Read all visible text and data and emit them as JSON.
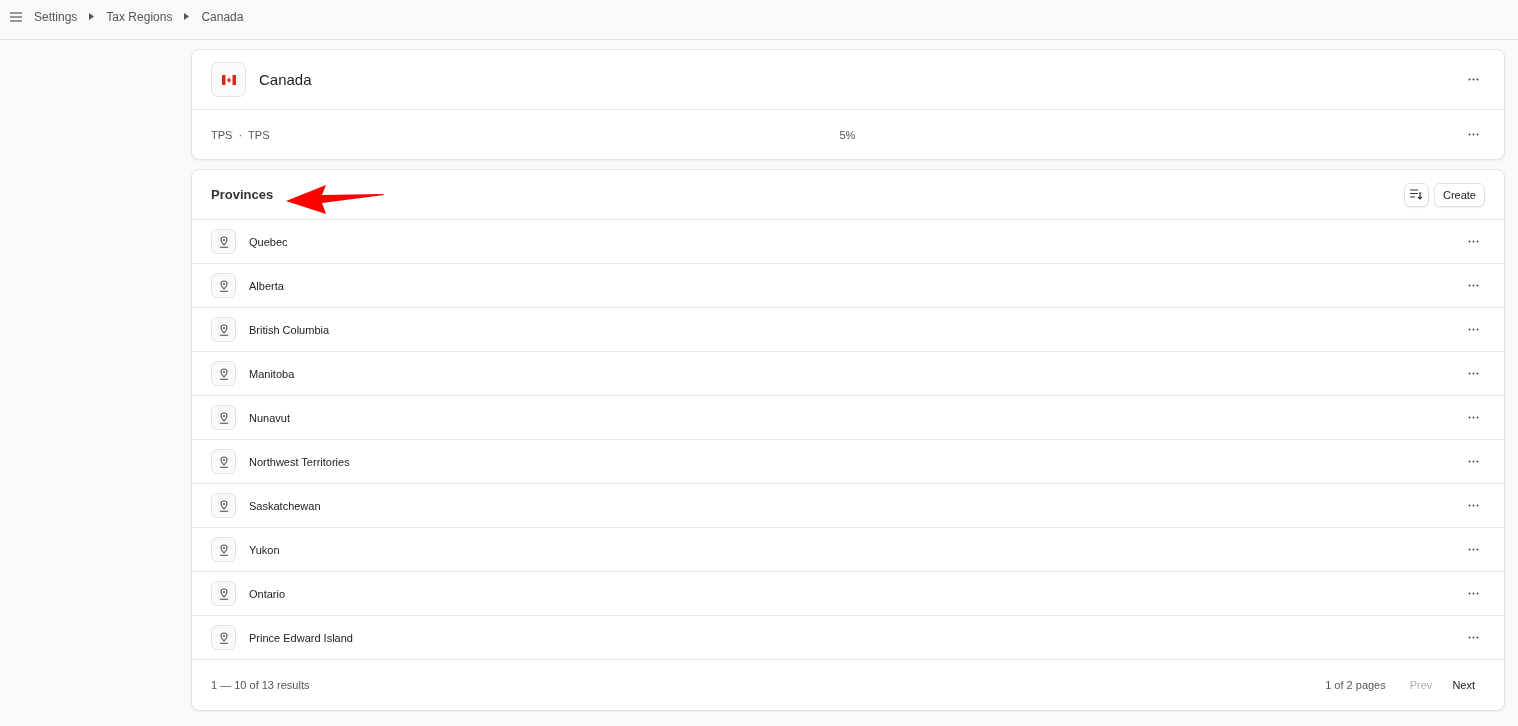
{
  "breadcrumb": [
    "Settings",
    "Tax Regions",
    "Canada"
  ],
  "region": {
    "name": "Canada",
    "rate": {
      "name": "TPS",
      "separator": "·",
      "code": "TPS",
      "value": "5%"
    }
  },
  "provinces": {
    "title": "Provinces",
    "create_label": "Create",
    "items": [
      "Quebec",
      "Alberta",
      "British Columbia",
      "Manitoba",
      "Nunavut",
      "Northwest Territories",
      "Saskatchewan",
      "Yukon",
      "Ontario",
      "Prince Edward Island"
    ],
    "results": "1 — 10 of 13 results",
    "pages": "1 of 2 pages",
    "prev": {
      "label": "Prev",
      "disabled": true
    },
    "next": {
      "label": "Next",
      "disabled": false
    }
  }
}
